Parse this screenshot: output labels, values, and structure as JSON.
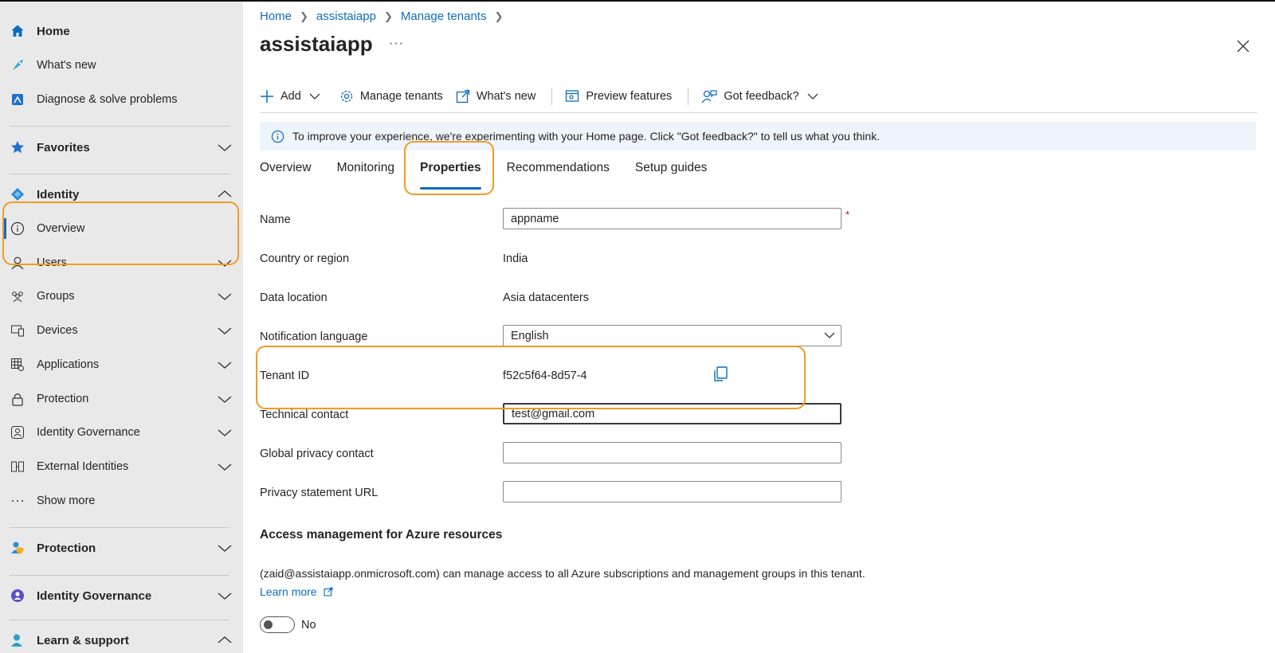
{
  "sidebar": {
    "home": "Home",
    "whats_new": "What's new",
    "diagnose": "Diagnose & solve problems",
    "favorites": "Favorites",
    "identity": "Identity",
    "overview": "Overview",
    "users": "Users",
    "groups": "Groups",
    "devices": "Devices",
    "applications": "Applications",
    "protection": "Protection",
    "identity_governance": "Identity Governance",
    "external_identities": "External Identities",
    "show_more": "Show more",
    "protection_section": "Protection",
    "identity_governance_section": "Identity Governance",
    "learn_support": "Learn & support"
  },
  "breadcrumb": [
    "Home",
    "assistaiapp",
    "Manage tenants"
  ],
  "page": {
    "title": "assistaiapp",
    "more": "···"
  },
  "toolbar": {
    "add": "Add",
    "manage_tenants": "Manage tenants",
    "whats_new": "What's new",
    "preview_features": "Preview features",
    "got_feedback": "Got feedback?"
  },
  "infobar": {
    "text": "To improve your experience, we're experimenting with your Home page. Click \"Got feedback?\" to tell us what you think."
  },
  "tabs": [
    "Overview",
    "Monitoring",
    "Properties",
    "Recommendations",
    "Setup guides"
  ],
  "active_tab": "Properties",
  "form": {
    "name_label": "Name",
    "name_value": "appname",
    "required_mark": "*",
    "country_label": "Country or region",
    "country_value": "India",
    "data_location_label": "Data location",
    "data_location_value": "Asia datacenters",
    "notification_language_label": "Notification language",
    "notification_language_value": "English",
    "tenant_id_label": "Tenant ID",
    "tenant_id_value": "f52c5f64-8d57-4",
    "technical_contact_label": "Technical contact",
    "technical_contact_value": "test@gmail.com",
    "global_privacy_label": "Global privacy contact",
    "global_privacy_value": "",
    "privacy_url_label": "Privacy statement URL",
    "privacy_url_value": ""
  },
  "access": {
    "title": "Access management for Azure resources",
    "description": "(zaid@assistaiapp.onmicrosoft.com) can manage access to all Azure subscriptions and management groups in this tenant.",
    "learn_more": "Learn more",
    "toggle_label": "No",
    "toggle_on": false
  },
  "colors": {
    "accent": "#0f6cbd",
    "highlight": "#f59a23",
    "sidebar_bg": "#e9e9e9",
    "infobar_bg": "#eef4fb"
  }
}
